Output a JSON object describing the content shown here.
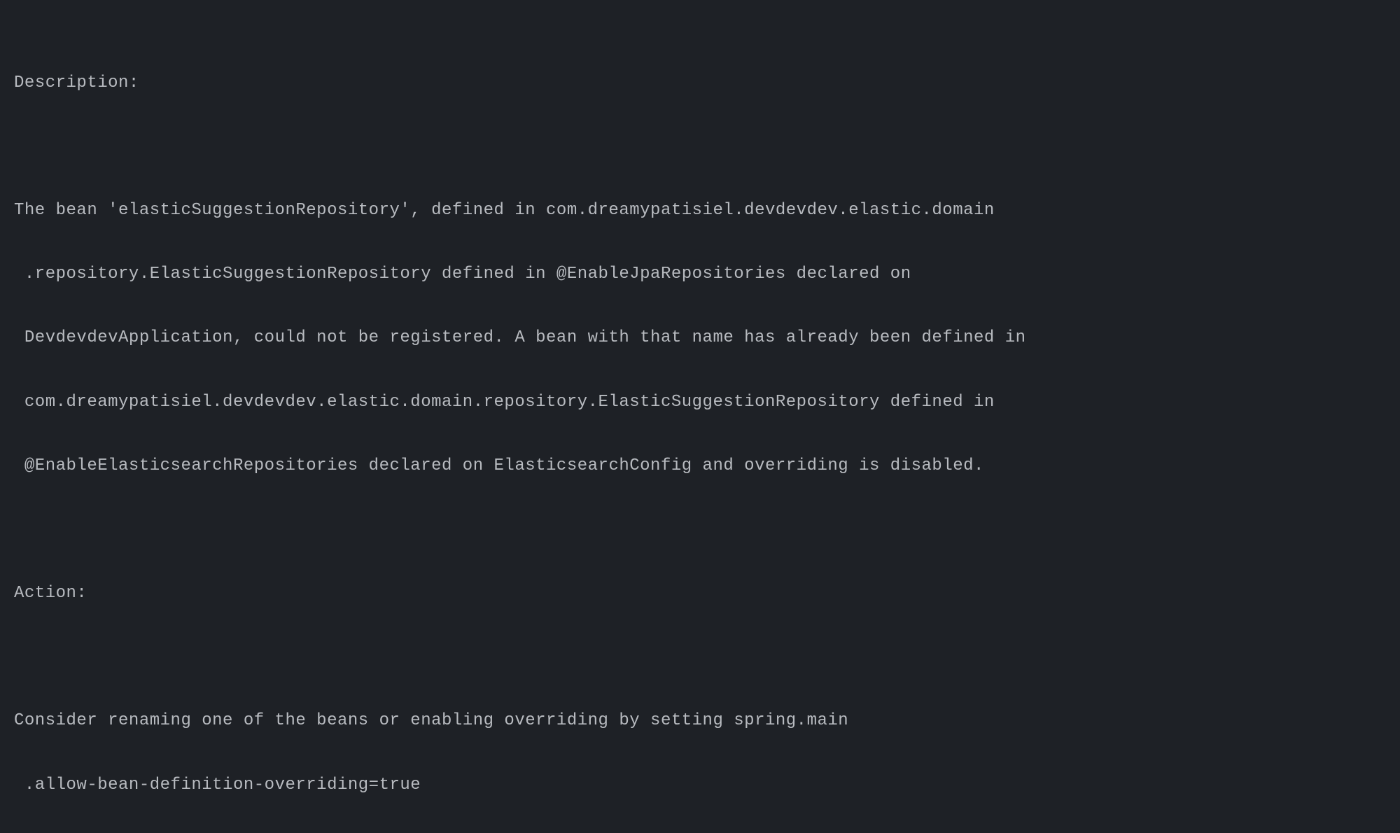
{
  "console": {
    "description_header": "Description:",
    "description_line1": "The bean 'elasticSuggestionRepository', defined in com.dreamypatisiel.devdevdev.elastic.domain",
    "description_line2": " .repository.ElasticSuggestionRepository defined in @EnableJpaRepositories declared on",
    "description_line3": " DevdevdevApplication, could not be registered. A bean with that name has already been defined in",
    "description_line4": " com.dreamypatisiel.devdevdev.elastic.domain.repository.ElasticSuggestionRepository defined in",
    "description_line5": " @EnableElasticsearchRepositories declared on ElasticsearchConfig and overriding is disabled.",
    "action_header": "Action:",
    "action_line1": "Consider renaming one of the beans or enabling overriding by setting spring.main",
    "action_line2": " .allow-bean-definition-overriding=true"
  }
}
